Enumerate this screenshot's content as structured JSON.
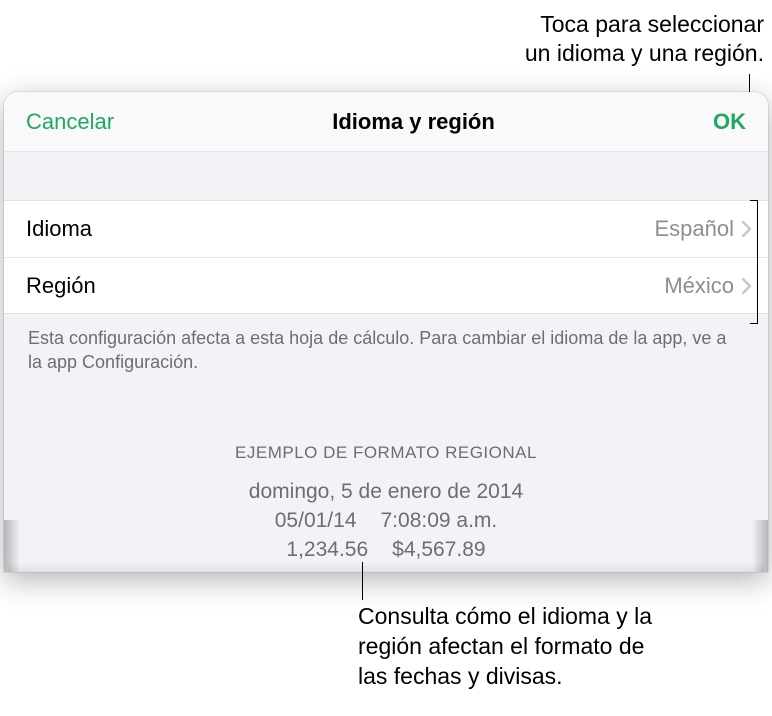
{
  "callouts": {
    "top_line1": "Toca para seleccionar",
    "top_line2": "un idioma y una región.",
    "bottom_line1": "Consulta cómo el idioma y la",
    "bottom_line2": "región afectan el formato de",
    "bottom_line3": "las fechas y divisas."
  },
  "modal": {
    "cancel": "Cancelar",
    "title": "Idioma y región",
    "ok": "OK",
    "rows": {
      "language": {
        "label": "Idioma",
        "value": "Español"
      },
      "region": {
        "label": "Región",
        "value": "México"
      }
    },
    "footer": "Esta configuración afecta a esta hoja de cálculo. Para cambiar el idioma de la app, ve a la app Configuración.",
    "example": {
      "header": "EJEMPLO DE FORMATO REGIONAL",
      "date_long": "domingo, 5 de enero de 2014",
      "date_short": "05/01/14",
      "time": "7:08:09 a.m.",
      "number": "1,234.56",
      "currency": "$4,567.89"
    }
  }
}
